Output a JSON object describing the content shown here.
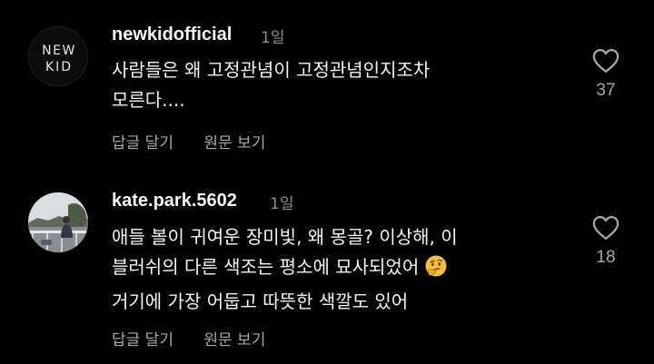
{
  "comments": [
    {
      "username": "newkidofficial",
      "time": "1일",
      "avatar_text": [
        "NEW",
        "KID"
      ],
      "lines": [
        "사람들은 왜 고정관념이 고정관념인지조차",
        "모른다...."
      ],
      "reply_label": "답글 달기",
      "translate_label": "원문 보기",
      "likes": "37",
      "heart_icon": "heart-outline-icon"
    },
    {
      "username": "kate.park.5602",
      "time": "1일",
      "lines": [
        "애들 볼이 귀여운 장미빛, 왜 몽골? 이상해, 이",
        "블러쉬의 다른 색조는 평소에 묘사되었어",
        "거기에 가장 어둡고 따뜻한 색깔도 있어"
      ],
      "emoji": "thinking-face-emoji",
      "reply_label": "답글 달기",
      "translate_label": "원문 보기",
      "likes": "18",
      "heart_icon": "heart-outline-icon"
    }
  ],
  "colors": {
    "background": "#000000",
    "primary_text": "#f5f5f5",
    "secondary_text": "#a8a8a8",
    "meta_text": "#8e8e8e"
  }
}
